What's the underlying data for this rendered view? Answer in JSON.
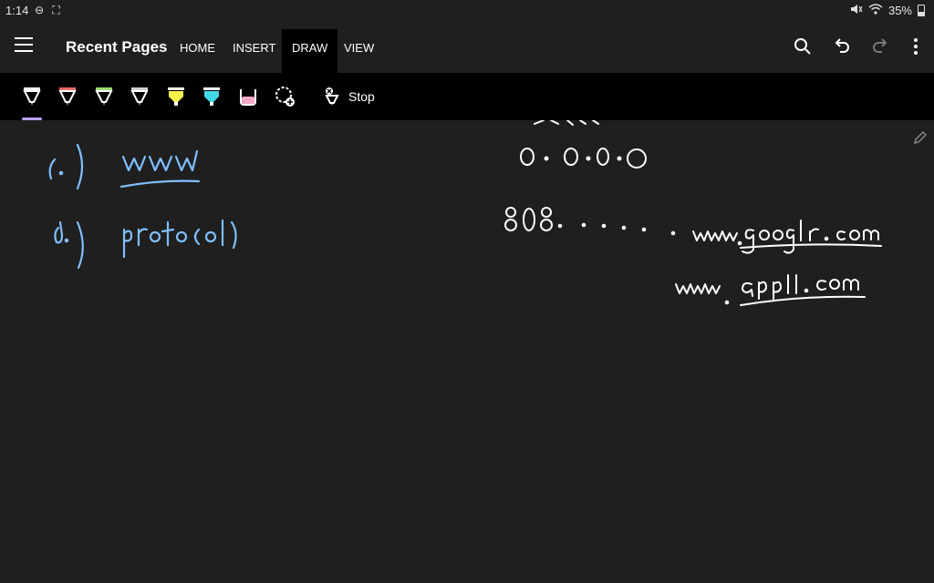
{
  "status": {
    "time": "1:14",
    "battery": "35%"
  },
  "appbar": {
    "title": "Recent Pages",
    "tabs": [
      "HOME",
      "INSERT",
      "DRAW",
      "VIEW"
    ],
    "active_tab": "DRAW"
  },
  "ribbon": {
    "pens": [
      {
        "name": "pen-white",
        "color": "#ffffff"
      },
      {
        "name": "pen-red",
        "color": "#f06a6a"
      },
      {
        "name": "pen-green",
        "color": "#9ddc6f"
      },
      {
        "name": "pen-gray",
        "color": "#d0d0d0"
      },
      {
        "name": "highlighter-yellow",
        "color": "#f7f24c"
      },
      {
        "name": "highlighter-cyan",
        "color": "#44d9e6"
      },
      {
        "name": "highlighter-pink",
        "color": "#f3a9c5"
      }
    ],
    "stop_label": "Stop"
  },
  "notes": {
    "left": [
      {
        "label": "c.)",
        "text": "www"
      },
      {
        "label": "d.)",
        "text": "protocol"
      }
    ],
    "right": [
      "0.0.0.0",
      "808. . . . . . www.google.com",
      "www.apple.com"
    ]
  },
  "colors": {
    "ink_blue": "#7fbfff",
    "ink_white": "#ffffff",
    "background": "#1f1f1f"
  }
}
